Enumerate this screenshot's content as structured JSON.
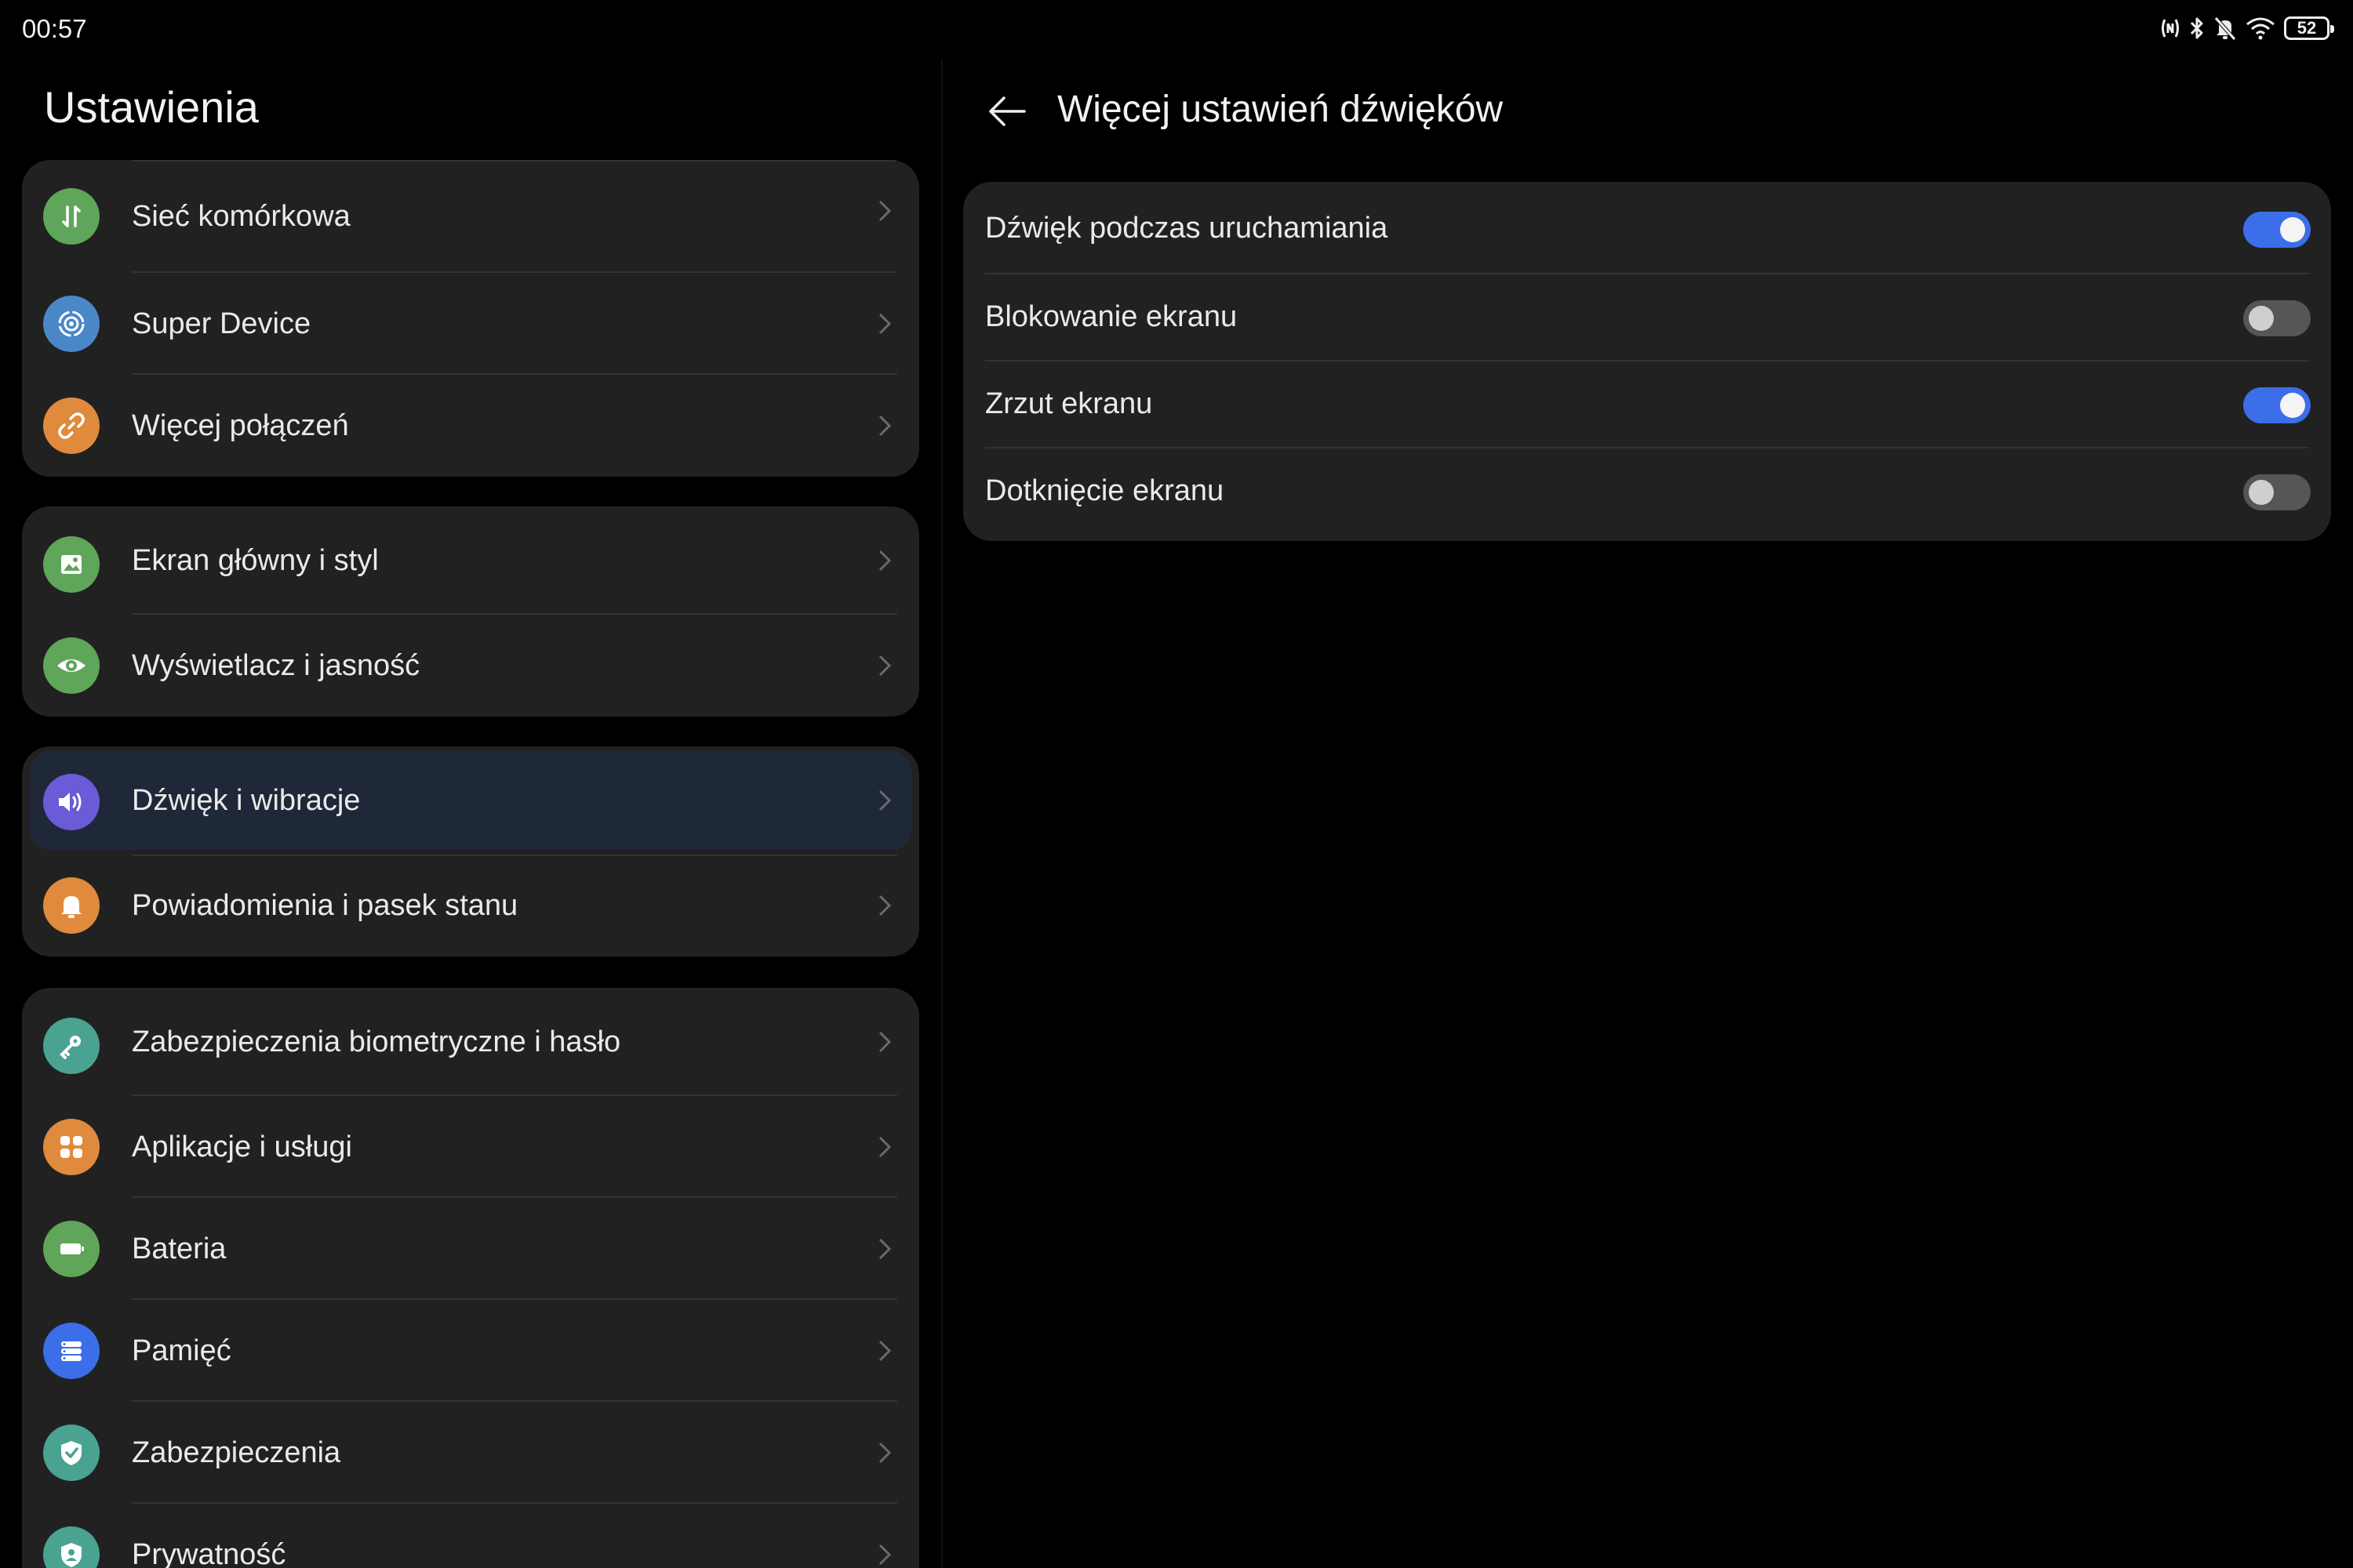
{
  "status_bar": {
    "time": "00:57",
    "battery_level": "52",
    "icons": [
      "nfc-icon",
      "bluetooth-icon",
      "mute-icon",
      "wifi-icon",
      "battery-icon"
    ]
  },
  "left": {
    "title": "Ustawienia",
    "groups": [
      {
        "items": [
          {
            "label": "Sieć komórkowa",
            "icon": "mobile-data-icon",
            "color": "#5fa55a"
          },
          {
            "label": "Super Device",
            "icon": "super-device-icon",
            "color": "#4a87c8"
          },
          {
            "label": "Więcej połączeń",
            "icon": "link-icon",
            "color": "#e08a3e"
          }
        ]
      },
      {
        "items": [
          {
            "label": "Ekran główny i styl",
            "icon": "wallpaper-icon",
            "color": "#5fa55a"
          },
          {
            "label": "Wyświetlacz i jasność",
            "icon": "eye-icon",
            "color": "#5fa55a"
          }
        ]
      },
      {
        "items": [
          {
            "label": "Dźwięk i wibracje",
            "icon": "speaker-icon",
            "color": "#6a5bd6",
            "selected": true
          },
          {
            "label": "Powiadomienia i pasek stanu",
            "icon": "bell-icon",
            "color": "#e08a3e"
          }
        ]
      },
      {
        "items": [
          {
            "label": "Zabezpieczenia biometryczne i hasło",
            "icon": "key-icon",
            "color": "#4aa390"
          },
          {
            "label": "Aplikacje i usługi",
            "icon": "apps-icon",
            "color": "#e08a3e"
          },
          {
            "label": "Bateria",
            "icon": "battery-icon",
            "color": "#5fa55a"
          },
          {
            "label": "Pamięć",
            "icon": "storage-icon",
            "color": "#3b6ee8"
          },
          {
            "label": "Zabezpieczenia",
            "icon": "shield-icon",
            "color": "#4aa390"
          },
          {
            "label": "Prywatność",
            "icon": "privacy-icon",
            "color": "#4aa390"
          }
        ]
      }
    ]
  },
  "right": {
    "title": "Więcej ustawień dźwięków",
    "toggles": [
      {
        "label": "Dźwięk podczas uruchamiania",
        "on": true
      },
      {
        "label": "Blokowanie ekranu",
        "on": false
      },
      {
        "label": "Zrzut ekranu",
        "on": true
      },
      {
        "label": "Dotknięcie ekranu",
        "on": false
      }
    ]
  },
  "colors": {
    "accent": "#3b6ee8",
    "card_bg": "#212121",
    "selected_bg": "#1f2838"
  }
}
